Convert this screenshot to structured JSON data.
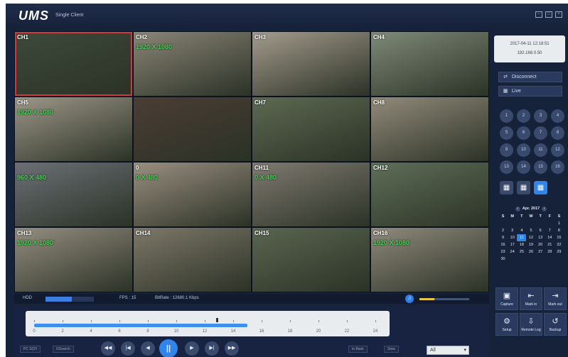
{
  "app": {
    "logo": "UMS",
    "logo_sub": "Single Client"
  },
  "grid": {
    "tiles": [
      {
        "label": "CH1",
        "resolution": ""
      },
      {
        "label": "CH2",
        "resolution": "1920 X 1080"
      },
      {
        "label": "CH3",
        "resolution": ""
      },
      {
        "label": "CH4",
        "resolution": ""
      },
      {
        "label": "CH5",
        "resolution": "1920 X 1080"
      },
      {
        "label": "",
        "resolution": ""
      },
      {
        "label": "CH7",
        "resolution": ""
      },
      {
        "label": "CH8",
        "resolution": ""
      },
      {
        "label": "",
        "resolution": "960 X 480"
      },
      {
        "label": "0",
        "resolution": "0 X 480"
      },
      {
        "label": "CH11",
        "resolution": "0 X 480"
      },
      {
        "label": "CH12",
        "resolution": ""
      },
      {
        "label": "CH13",
        "resolution": "1920 X 1080"
      },
      {
        "label": "CH14",
        "resolution": ""
      },
      {
        "label": "CH15",
        "resolution": ""
      },
      {
        "label": "CH16",
        "resolution": "1920 X 1080"
      }
    ]
  },
  "status": {
    "hdd_label": "HDD",
    "hdd_fill": 0.55,
    "fps": "FPS : 15",
    "bitrate": "BitRate : 12680.1 Kbps",
    "volume_level": 0.3
  },
  "timeline": {
    "ticks": [
      "0",
      "2",
      "4",
      "6",
      "8",
      "10",
      "12",
      "14",
      "16",
      "18",
      "20",
      "22",
      "24"
    ],
    "left_buttons": [
      "PC SCH",
      "GSearch"
    ],
    "right_buttons": [
      "In Back",
      "Slow"
    ],
    "select_value": "All"
  },
  "side": {
    "datetime": "2017-04-11 12:18:51",
    "ip": "192.168.0.50",
    "disconnect_label": "Disconnect",
    "live_label": "Live",
    "channels": [
      "1",
      "2",
      "3",
      "4",
      "5",
      "6",
      "7",
      "8",
      "9",
      "10",
      "11",
      "12",
      "13",
      "14",
      "15",
      "16"
    ],
    "calendar": {
      "month": "Apr. 2017",
      "dow": [
        "S",
        "M",
        "T",
        "W",
        "T",
        "F",
        "S"
      ],
      "weeks": [
        [
          "",
          "",
          "",
          "",
          "",
          "",
          "1"
        ],
        [
          "2",
          "3",
          "4",
          "5",
          "6",
          "7",
          "8"
        ],
        [
          "9",
          "10",
          "11",
          "12",
          "13",
          "14",
          "15"
        ],
        [
          "16",
          "17",
          "18",
          "19",
          "20",
          "21",
          "22"
        ],
        [
          "23",
          "24",
          "25",
          "26",
          "27",
          "28",
          "29"
        ],
        [
          "30",
          "",
          "",
          "",
          "",
          "",
          ""
        ]
      ],
      "today": "11"
    },
    "tools": [
      {
        "label": "Capture",
        "icon": "camera-icon"
      },
      {
        "label": "Mark in",
        "icon": "mark-in-icon"
      },
      {
        "label": "Mark out",
        "icon": "mark-out-icon"
      },
      {
        "label": "Setup",
        "icon": "setup-icon"
      },
      {
        "label": "Remote Log",
        "icon": "remote-log-icon"
      },
      {
        "label": "Backup",
        "icon": "backup-icon"
      }
    ]
  }
}
